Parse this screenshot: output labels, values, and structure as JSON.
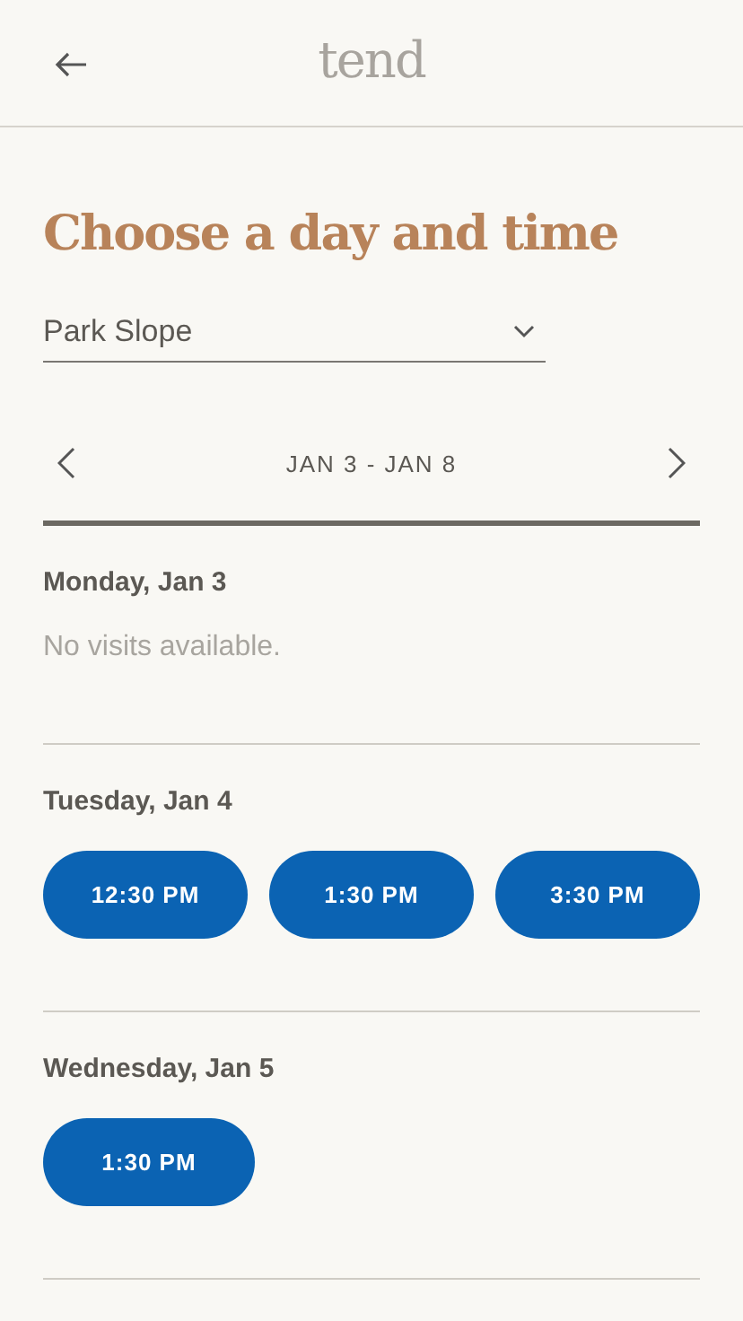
{
  "header": {
    "logo": "tend"
  },
  "title": "Choose a day and time",
  "location": {
    "value": "Park Slope"
  },
  "week": {
    "range": "JAN 3 - JAN 8"
  },
  "days": [
    {
      "label": "Monday, Jan 3",
      "message": "No visits available."
    },
    {
      "label": "Tuesday, Jan 4",
      "slots": [
        "12:30 PM",
        "1:30 PM",
        "3:30 PM"
      ]
    },
    {
      "label": "Wednesday, Jan 5",
      "slots": [
        "1:30 PM"
      ]
    }
  ]
}
